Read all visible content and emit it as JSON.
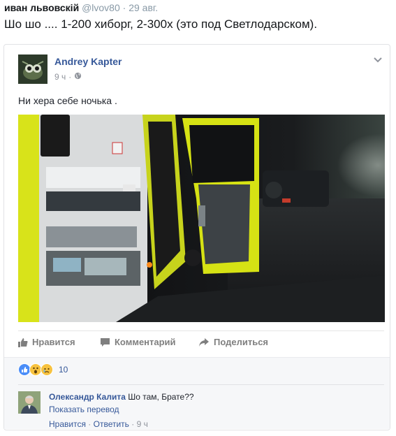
{
  "tweet": {
    "name": "иван львовскій",
    "handle": "@lvov80",
    "dot": "·",
    "date": "29 авг.",
    "text": "Шо шо .... 1-200 хиборг, 2-300х (это под Светлодарском)."
  },
  "post": {
    "author": "Andrey Kapter",
    "time": "9 ч",
    "dot": "·",
    "privacy_icon": "globe-icon",
    "text": "Ни хера себе ночька ."
  },
  "actions": {
    "like": "Нравится",
    "comment": "Комментарий",
    "share": "Поделиться"
  },
  "reactions": {
    "types": [
      "like",
      "wow",
      "sad"
    ],
    "count": "10"
  },
  "comment": {
    "author": "Олександр Калита",
    "text": "Шо там, Брате??",
    "translate": "Показать перевод",
    "like": "Нравится",
    "sep": "·",
    "reply": "Ответить",
    "time": "9 ч"
  },
  "colors": {
    "link": "#365899",
    "meta": "#90949c",
    "like_blue": "#4a8df8",
    "emoji_yellow": "#f7c23f"
  }
}
